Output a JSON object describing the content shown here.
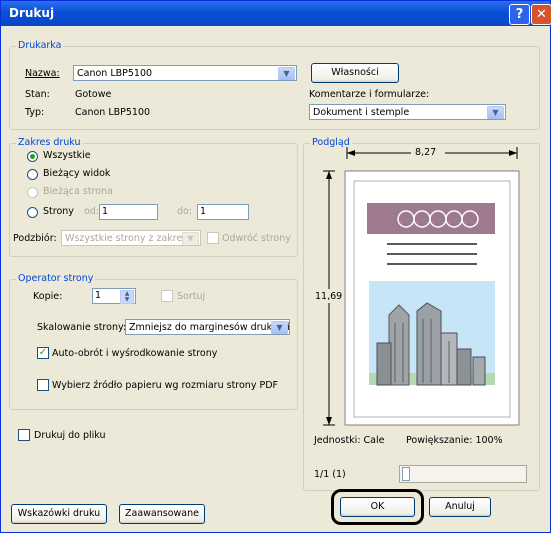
{
  "window": {
    "title": "Drukuj"
  },
  "printer": {
    "group_label": "Drukarka",
    "name_label": "Nazwa:",
    "name_value": "Canon LBP5100",
    "status_label": "Stan:",
    "status_value": "Gotowe",
    "type_label": "Typ:",
    "type_value": "Canon LBP5100",
    "properties_button": "Własności",
    "comments_label": "Komentarze i formularze:",
    "comments_value": "Dokument i stemple"
  },
  "range": {
    "group_label": "Zakres druku",
    "all": "Wszystkie",
    "current_view": "Bieżący widok",
    "current_page": "Bieżąca strona",
    "pages": "Strony",
    "from_label": "od:",
    "from_value": "1",
    "to_label": "do:",
    "to_value": "1",
    "subset_label": "Podzbiór:",
    "subset_value": "Wszystkie strony z zakresu",
    "reverse": "Odwróć strony"
  },
  "handling": {
    "group_label": "Operator strony",
    "copies_label": "Kopie:",
    "copies_value": "1",
    "collate": "Sortuj",
    "scaling_label": "Skalowanie strony:",
    "scaling_value": "Zmniejsz do marginesów drukarki",
    "auto_rotate": "Auto-obrót i wyśrodkowanie strony",
    "auto_rotate_checked": true,
    "choose_source": "Wybierz źródło papieru wg rozmiaru strony PDF",
    "choose_source_checked": false
  },
  "print_to_file": "Drukuj do pliku",
  "preview": {
    "group_label": "Podgląd",
    "width": "8,27",
    "height": "11,69",
    "units": "Jednostki: Cale",
    "zoom": "Powiększanie: 100%",
    "page_counter": "1/1 (1)"
  },
  "buttons": {
    "tips": "Wskazówki druku",
    "advanced": "Zaawansowane",
    "ok": "OK",
    "cancel": "Anuluj"
  }
}
